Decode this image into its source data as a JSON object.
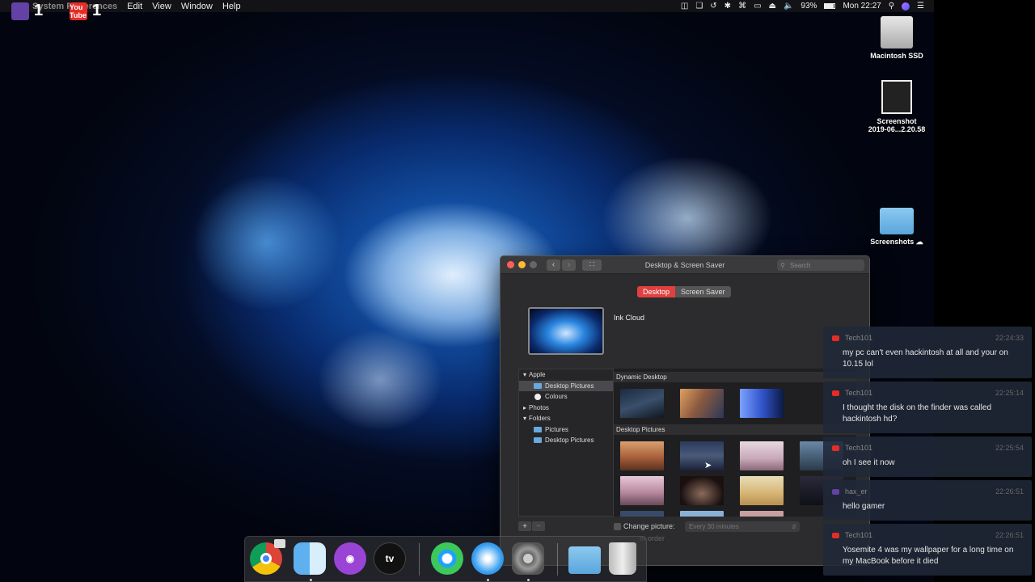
{
  "menubar": {
    "app_name": "System Preferences",
    "items": [
      "Edit",
      "View",
      "Window",
      "Help"
    ],
    "battery": "93%",
    "clock": "Mon 22:27"
  },
  "stream": {
    "twitch_count": "1",
    "youtube_count": "1",
    "youtube_icon_text": "You Tube",
    "colors": {
      "twitch": "#6441a5",
      "youtube": "#e52d27"
    }
  },
  "desktop": {
    "icons": [
      {
        "label": "Macintosh SSD"
      },
      {
        "label": "Screenshot\n2019-06...2.20.58"
      },
      {
        "label": "Screenshots"
      }
    ]
  },
  "window": {
    "title": "Desktop & Screen Saver",
    "search_placeholder": "Search",
    "tabs": [
      {
        "label": "Desktop",
        "active": true
      },
      {
        "label": "Screen Saver",
        "active": false
      }
    ],
    "current_picture": "Ink Cloud",
    "sidebar": [
      {
        "label": "Apple",
        "type": "group",
        "expanded": true
      },
      {
        "label": "Desktop Pictures",
        "type": "folder",
        "selected": true
      },
      {
        "label": "Colours",
        "type": "colours"
      },
      {
        "label": "Photos",
        "type": "group",
        "expanded": false
      },
      {
        "label": "Folders",
        "type": "group",
        "expanded": true
      },
      {
        "label": "Pictures",
        "type": "folder"
      },
      {
        "label": "Desktop Pictures",
        "type": "folder"
      }
    ],
    "sections": [
      {
        "label": "Dynamic Desktop"
      },
      {
        "label": "Desktop Pictures"
      }
    ],
    "add_label": "+",
    "remove_label": "−",
    "change_picture_label": "Change picture:",
    "change_interval": "Every 30 minutes",
    "random_order_label": "m order"
  },
  "dock": [
    {
      "name": "chrome",
      "label": ""
    },
    {
      "name": "finder",
      "label": ""
    },
    {
      "name": "podcasts",
      "label": ""
    },
    {
      "name": "apple-tv",
      "label": "tv"
    },
    {
      "name": "find-my",
      "label": ""
    },
    {
      "name": "safari",
      "label": ""
    },
    {
      "name": "system-preferences",
      "label": ""
    },
    {
      "name": "downloads-folder",
      "label": ""
    },
    {
      "name": "trash",
      "label": ""
    }
  ],
  "chat": [
    {
      "user": "Tech101",
      "time": "22:24:33",
      "text": "my pc can't even hackintosh at all and your on 10.15 lol",
      "platform": "youtube"
    },
    {
      "user": "Tech101",
      "time": "22:25:14",
      "text": "I thought the disk on the finder was called hackintosh hd?",
      "platform": "youtube"
    },
    {
      "user": "Tech101",
      "time": "22:25:54",
      "text": "oh I see it now",
      "platform": "youtube"
    },
    {
      "user": "hax_er",
      "time": "22:26:51",
      "text": "hello gamer",
      "platform": "twitch"
    },
    {
      "user": "Tech101",
      "time": "22:26:51",
      "text": "Yosemite 4 was my wallpaper for a long time on my MacBook before it died",
      "platform": "youtube"
    }
  ]
}
